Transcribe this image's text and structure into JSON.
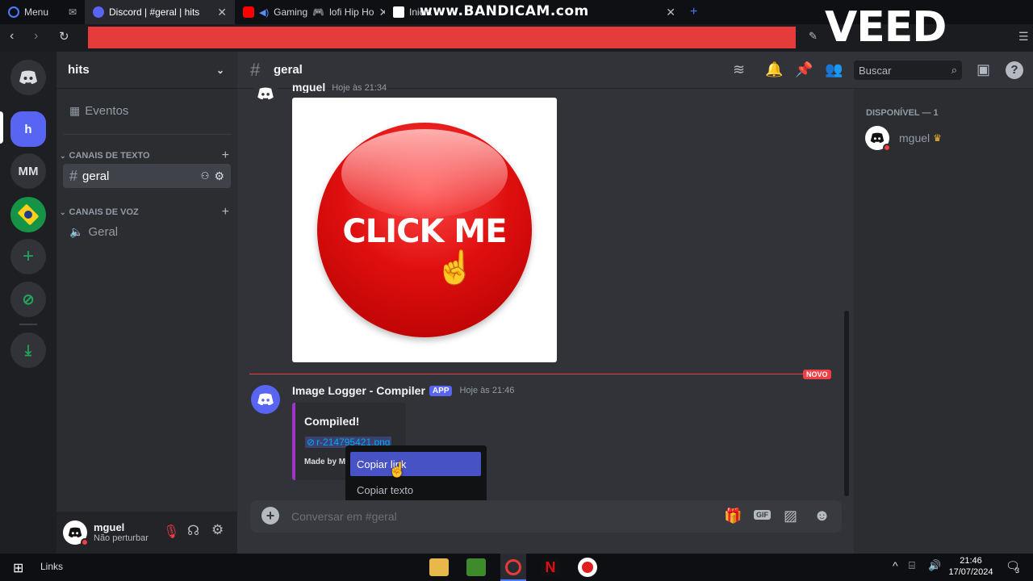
{
  "browser": {
    "menu_label": "Menu",
    "tabs": [
      {
        "label": "Discord | #geral | hits"
      },
      {
        "label": "Gaming"
      },
      {
        "label": "lofi Hip Ho"
      },
      {
        "label": "Inicia"
      }
    ],
    "watermark": "www.BANDICAM.com",
    "veed_logo": "VEED"
  },
  "guild": {
    "name": "hits",
    "events_label": "Eventos",
    "text_category": "CANAIS DE TEXTO",
    "voice_category": "CANAIS DE VOZ",
    "text_channels": [
      {
        "name": "geral"
      }
    ],
    "voice_channels": [
      {
        "name": "Geral"
      }
    ]
  },
  "servers": [
    {
      "label": "h"
    },
    {
      "label": "MM"
    }
  ],
  "channel_header": {
    "name": "geral",
    "search_placeholder": "Buscar"
  },
  "messages": [
    {
      "author": "mguel",
      "timestamp": "Hoje às 21:34",
      "image_text": "CLICK ME"
    },
    {
      "author": "Image Logger - Compiler",
      "badge": "APP",
      "timestamp": "Hoje às 21:46",
      "embed_title": "Compiled!",
      "embed_link": "r-214795421.png",
      "embed_footer": "Made by M"
    }
  ],
  "new_divider": "NOVO",
  "context_menu": {
    "items": [
      {
        "label": "Copiar link"
      },
      {
        "label": "Copiar texto"
      }
    ]
  },
  "composer": {
    "placeholder": "Conversar em #geral",
    "gif_label": "GIF"
  },
  "members": {
    "section": "DISPONÍVEL — 1",
    "list": [
      {
        "name": "mguel"
      }
    ]
  },
  "user_panel": {
    "username": "mguel",
    "status": "Não perturbar"
  },
  "taskbar": {
    "links_label": "Links",
    "time": "21:46",
    "date": "17/07/2024",
    "notif_count": "3"
  },
  "colors": {
    "accent": "#5865f2",
    "red": "#e63b3b",
    "embed_bar": "#a034c8",
    "green": "#23a55a"
  }
}
